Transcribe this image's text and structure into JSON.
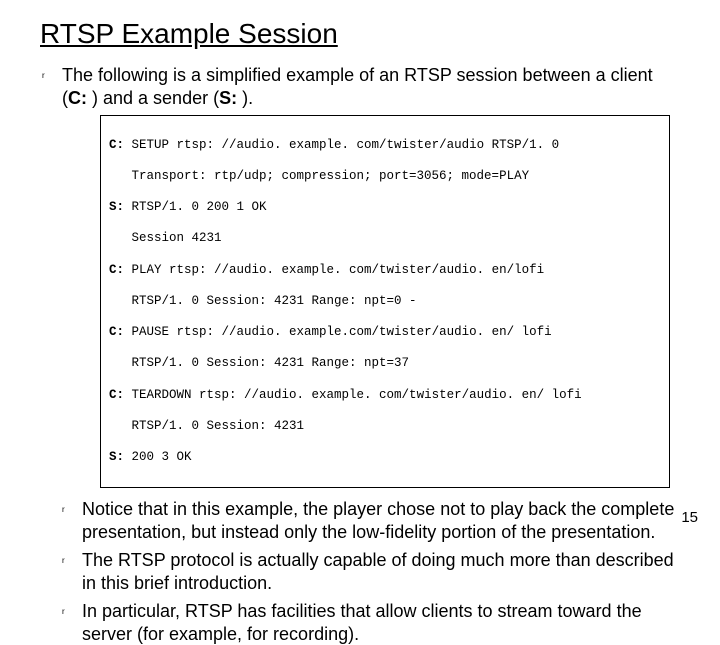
{
  "title": "RTSP Example Session",
  "intro": "The following is a simplified example of an RTSP session between a client (",
  "intro_c": "C:",
  "intro_mid": " ) and a sender (",
  "intro_s": "S:",
  "intro_end": " ).",
  "code": {
    "p0": "C:",
    "l0": " SETUP rtsp: //audio. example. com/twister/audio RTSP/1. 0",
    "l1": "   Transport: rtp/udp; compression; port=3056; mode=PLAY",
    "p2": "S:",
    "l2": " RTSP/1. 0 200 1 OK",
    "l3": "   Session 4231",
    "p4": "C:",
    "l4": " PLAY rtsp: //audio. example. com/twister/audio. en/lofi",
    "l5": "   RTSP/1. 0 Session: 4231 Range: npt=0 -",
    "p6": "C:",
    "l6": " PAUSE rtsp: //audio. example.com/twister/audio. en/ lofi",
    "l7": "   RTSP/1. 0 Session: 4231 Range: npt=37",
    "p8": "C:",
    "l8": " TEARDOWN rtsp: //audio. example. com/twister/audio. en/ lofi",
    "l9": "   RTSP/1. 0 Session: 4231",
    "p10": "S:",
    "l10": " 200 3 OK"
  },
  "bullets": {
    "b1": "Notice that in this example, the player chose not to play back the complete presentation, but instead only the low-fidelity portion of the presentation.",
    "b2": "The RTSP protocol is actually capable of doing much more than described in this brief introduction.",
    "b3": "In particular, RTSP has facilities that allow clients to stream toward the server (for example, for recording)."
  },
  "page": "15"
}
